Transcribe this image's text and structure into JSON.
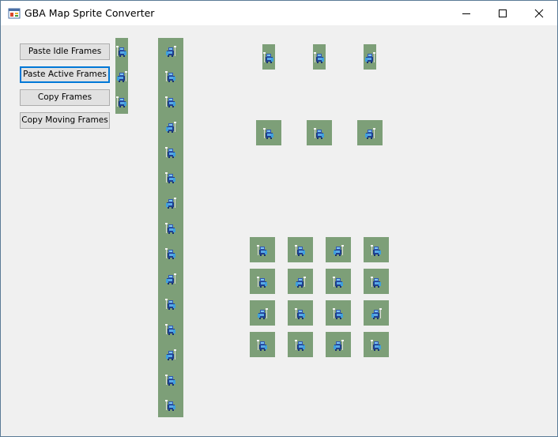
{
  "window": {
    "title": "GBA Map Sprite Converter",
    "controls": [
      "minimize",
      "maximize",
      "close"
    ],
    "icon": "app-window-icon"
  },
  "buttons": {
    "paste_idle": "Paste Idle Frames",
    "paste_active": "Paste Active Frames",
    "copy_frames": "Copy Frames",
    "copy_moving": "Copy Moving Frames"
  },
  "colors": {
    "sprite_background": "#7d9f78",
    "focus_border": "#0078d7",
    "window_background": "#f0f0f0"
  },
  "frames": {
    "idle_input": 3,
    "moving_strip": 15,
    "idle_output": 3,
    "active_output": 3,
    "moving_grid_rows": 4,
    "moving_grid_cols": 4
  }
}
